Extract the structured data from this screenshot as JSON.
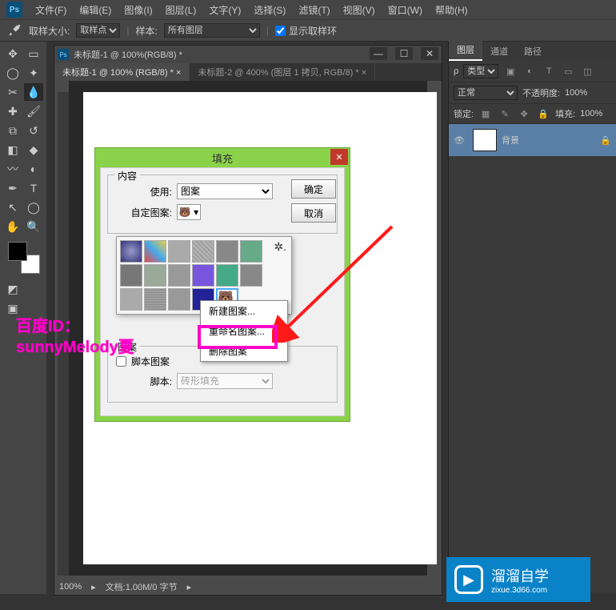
{
  "menubar": {
    "items": [
      "文件(F)",
      "编辑(E)",
      "图像(I)",
      "图层(L)",
      "文字(Y)",
      "选择(S)",
      "滤镜(T)",
      "视图(V)",
      "窗口(W)",
      "帮助(H)"
    ]
  },
  "optionbar": {
    "sample_label": "取样大小:",
    "sample_value": "取样点",
    "sample2_label": "样本:",
    "sample2_value": "所有图层",
    "show_ring": "显示取样环"
  },
  "docwin": {
    "title": "未标题-1 @ 100%(RGB/8) *",
    "tabs": [
      "未标题-1 @ 100% (RGB/8) *",
      "未标题-2 @ 400% (图层 1 拷贝, RGB/8) *"
    ]
  },
  "statusbar": {
    "zoom": "100%",
    "doc": "文档:1.00M/0 字节"
  },
  "fill": {
    "title": "填充",
    "content_legend": "内容",
    "use_label": "使用:",
    "use_value": "图案",
    "custom_label": "自定图案:",
    "blend_legend": "图案",
    "script_check": "脚本图案",
    "script_label": "脚本:",
    "script_value": "砖形填充",
    "ok": "确定",
    "cancel": "取消"
  },
  "ctx": {
    "new": "新建图案...",
    "rename": "重命名图案...",
    "del": "删除图案"
  },
  "watermark": {
    "line1": "百度ID：",
    "line2": "sunnyMelody夏"
  },
  "right": {
    "tabs": [
      "图层",
      "通道",
      "路径"
    ],
    "kind": "类型",
    "blend": "正常",
    "opacity_label": "不透明度:",
    "opacity": "100%",
    "lock_label": "锁定:",
    "fill_label": "填充:",
    "fill": "100%",
    "layer_name": "背景"
  },
  "brand": {
    "title": "溜溜自学",
    "sub": "zixue.3d66.com"
  }
}
